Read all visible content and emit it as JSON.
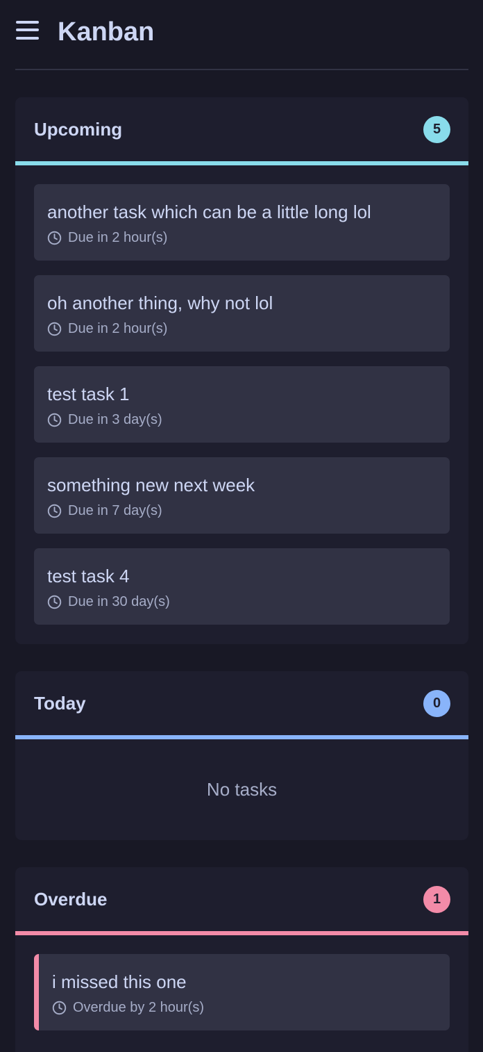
{
  "header": {
    "title": "Kanban",
    "menu_icon": "hamburger-menu-icon"
  },
  "columns": [
    {
      "title": "Upcoming",
      "count": "5",
      "accent": "#89dceb",
      "tasks": [
        {
          "title": "another task which can be a little long lol",
          "due": "Due in 2 hour(s)"
        },
        {
          "title": "oh another thing, why not lol",
          "due": "Due in 2 hour(s)"
        },
        {
          "title": "test task 1",
          "due": "Due in 3 day(s)"
        },
        {
          "title": "something new next week",
          "due": "Due in 7 day(s)"
        },
        {
          "title": "test task 4",
          "due": "Due in 30 day(s)"
        }
      ]
    },
    {
      "title": "Today",
      "count": "0",
      "accent": "#89b4fa",
      "empty_text": "No tasks",
      "tasks": []
    },
    {
      "title": "Overdue",
      "count": "1",
      "accent": "#f38ba8",
      "tasks": [
        {
          "title": "i missed this one",
          "due": "Overdue by 2 hour(s)"
        }
      ]
    }
  ],
  "icons": {
    "due": "clock-icon"
  }
}
